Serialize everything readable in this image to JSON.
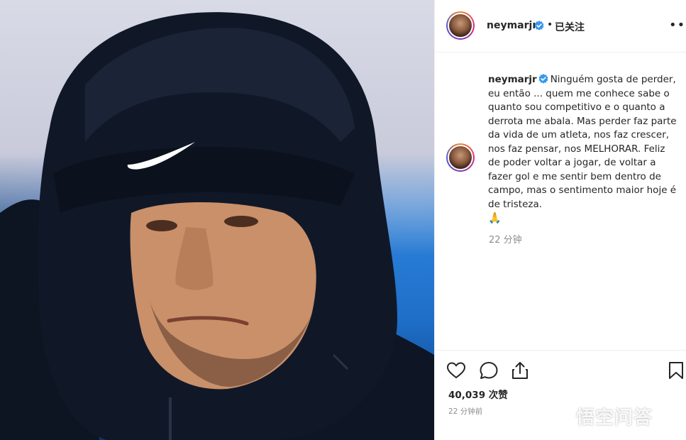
{
  "header": {
    "username": "neymarjr",
    "separator": "•",
    "follow_status": "已关注",
    "more_label": "•••"
  },
  "caption": {
    "username": "neymarjr",
    "text": "Ninguém gosta de perder, eu então ... quem me conhece sabe o quanto sou competitivo e o quanto a derrota me abala. Mas perder faz parte da vida de um atleta, nos faz crescer, nos faz pensar, nos MELHORAR. Feliz de poder voltar a jogar, de voltar a fazer gol e me sentir bem dentro de campo, mas o sentimento maior hoje é de tristeza.",
    "emoji": "🙏",
    "time": "22 分钟"
  },
  "actions": {
    "likes": "40,039 次赞",
    "time": "22 分钟前"
  },
  "watermark": {
    "text": "悟空问答"
  },
  "icons": [
    "verified-icon",
    "more-icon",
    "heart-icon",
    "comment-icon",
    "share-icon",
    "bookmark-icon"
  ],
  "colors": {
    "verified": "#3897f0",
    "muted": "#8e8e8e",
    "text": "#262626"
  }
}
